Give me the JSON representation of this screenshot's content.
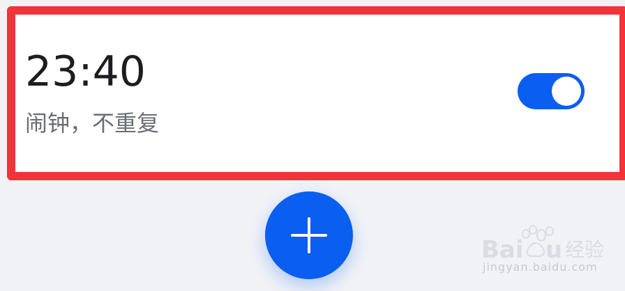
{
  "alarm": {
    "time": "23:40",
    "subtitle": "闹钟，不重复",
    "enabled": true
  },
  "actions": {
    "add_icon": "plus-icon"
  },
  "watermark": {
    "logo_text": "Baidu经验",
    "url_text": "jingyan.baidu.com"
  },
  "colors": {
    "accent": "#0a5ef0",
    "highlight": "#f0343a",
    "background": "#f1f2f6",
    "card": "#ffffff"
  }
}
